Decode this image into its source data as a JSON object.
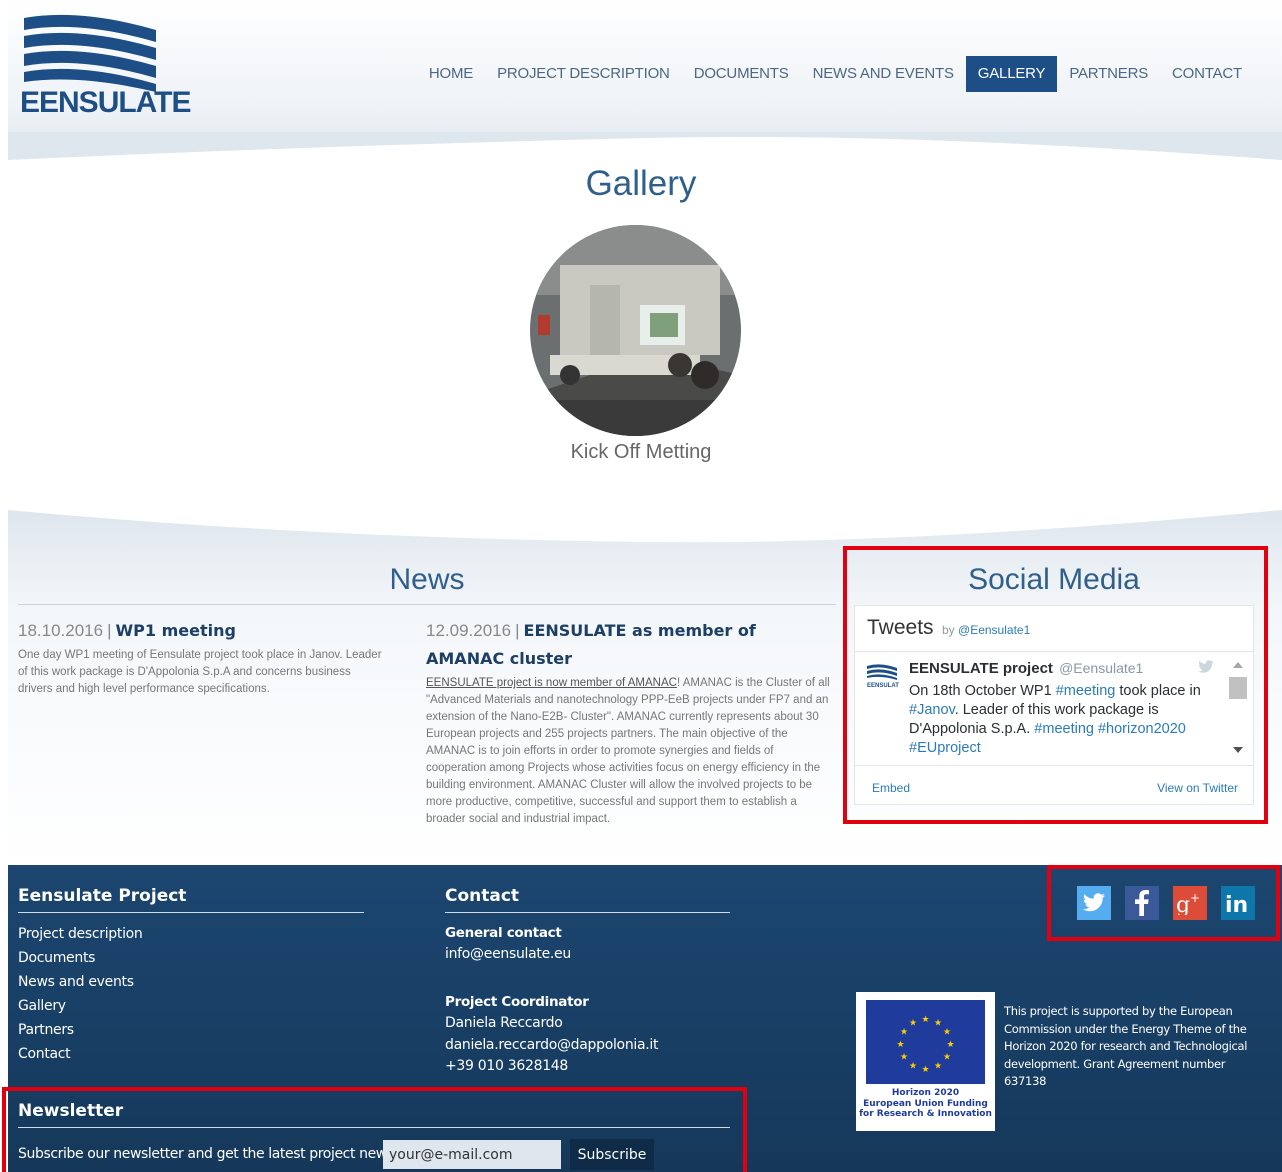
{
  "header": {
    "logo_text": "EENSULATE",
    "nav": [
      {
        "label": "HOME"
      },
      {
        "label": "PROJECT DESCRIPTION"
      },
      {
        "label": "DOCUMENTS"
      },
      {
        "label": "NEWS AND EVENTS"
      },
      {
        "label": "GALLERY",
        "active": true
      },
      {
        "label": "PARTNERS"
      },
      {
        "label": "CONTACT"
      }
    ]
  },
  "gallery": {
    "title": "Gallery",
    "item_caption": "Kick Off Metting"
  },
  "news": {
    "title": "News",
    "items": [
      {
        "date": "18.10.2016",
        "separator": "|",
        "title": "WP1 meeting",
        "body": "One day WP1 meeting of Eensulate project took place in Janov. Leader of this work package is D'Appolonia S.p.A and concerns business drivers and high level performance specifications."
      },
      {
        "date": "12.09.2016",
        "separator": "|",
        "title": "EENSULATE as member of AMANAC cluster",
        "body_link": "EENSULATE project is now member of AMANAC",
        "body": "! AMANAC is the Cluster of all \"Advanced Materials and nanotechnology PPP-EeB projects under FP7 and an extension of the Nano-E2B- Cluster\". AMANAC currently represents about 30 European projects and 255 projects partners. The main objective of the AMANAC is to join efforts in order to promote synergies and fields of cooperation among Projects whose activities focus on energy efficiency in the building environment. AMANAC Cluster will allow the involved projects to be more productive, competitive, successful and support them to establish a broader social and industrial impact."
      }
    ]
  },
  "social": {
    "title": "Social Media",
    "widget": {
      "heading": "Tweets",
      "by_label": "by",
      "by_handle": "@Eensulate1",
      "tweet_author": "EENSULATE project",
      "tweet_handle": "@Eensulate1",
      "tweet_text_1": "On 18th October WP1 ",
      "tweet_tag_meeting": "#meeting",
      "tweet_text_2": " took place in ",
      "tweet_tag_janov": "#Janov",
      "tweet_text_3": ". Leader of this work package is D'Appolonia S.p.A.  ",
      "tweet_tag_meeting2": "#meeting",
      "tweet_tag_horizon": " #horizon2020",
      "tweet_tag_euproject": "#EUproject",
      "embed_label": "Embed",
      "view_label": "View on Twitter"
    }
  },
  "footer": {
    "project_heading": "Eensulate Project",
    "links": [
      "Project description",
      "Documents",
      "News and events",
      "Gallery",
      "Partners",
      "Contact"
    ],
    "contact_heading": "Contact",
    "general_label": "General contact",
    "general_email": "info@eensulate.eu",
    "coordinator_label": "Project Coordinator",
    "coordinator_name": "Daniela Reccardo",
    "coordinator_email": "daniela.reccardo@dappolonia.it",
    "coordinator_phone": "+39 010 3628148",
    "eu_caption_1": "Horizon 2020",
    "eu_caption_2": "European Union Funding",
    "eu_caption_3": "for Research & Innovation",
    "eu_text": "This project is supported by the European Commission under the Energy Theme of the Horizon 2020 for research and Technological development. Grant Agreement number 637138",
    "newsletter_heading": "Newsletter",
    "newsletter_text": "Subscribe our newsletter and get the latest project news",
    "newsletter_placeholder": "your@e-mail.com",
    "subscribe_label": "Subscribe"
  },
  "colors": {
    "brand": "#1d4f86",
    "footer": "#1c4670",
    "annotation": "#e0000f",
    "twitter": "#55acee",
    "facebook": "#3b5998",
    "googleplus": "#dd4b39",
    "linkedin": "#0e76a8"
  }
}
